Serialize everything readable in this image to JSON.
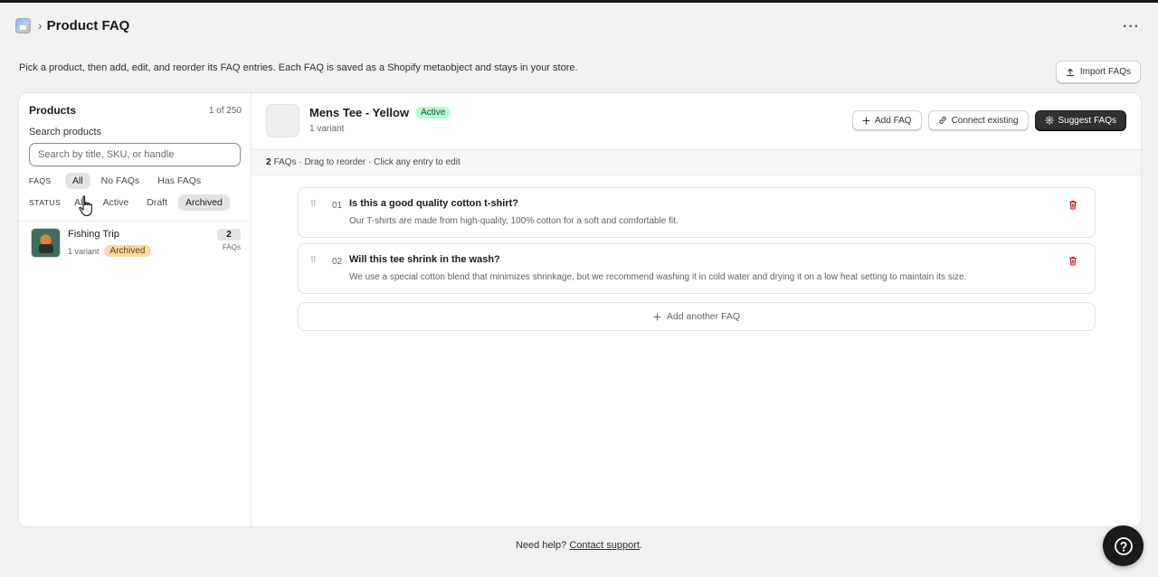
{
  "header": {
    "title": "Product FAQ",
    "breadcrumb_sep": "›",
    "more_label": "···"
  },
  "intro": "Pick a product, then add, edit, and reorder its FAQ entries. Each FAQ is saved as a Shopify metaobject and stays in your store.",
  "import_button": "Import FAQs",
  "sidebar": {
    "title": "Products",
    "count": "1 of 250",
    "search_label": "Search products",
    "search_placeholder": "Search by title, SKU, or handle",
    "search_value": "",
    "faq_filter": {
      "label": "FAQS",
      "options": [
        "All",
        "No FAQs",
        "Has FAQs"
      ],
      "selected": "All"
    },
    "status_filter": {
      "label": "STATUS",
      "options": [
        "All",
        "Active",
        "Draft",
        "Archived"
      ],
      "selected": "Archived"
    },
    "products": [
      {
        "name": "Fishing Trip",
        "variants": "1 variant",
        "status": "Archived",
        "faq_count": "2",
        "faq_count_label": "FAQs"
      }
    ]
  },
  "main": {
    "product_title": "Mens Tee - Yellow",
    "status": "Active",
    "variants": "1 variant",
    "actions": {
      "add_faq": "Add FAQ",
      "connect_existing": "Connect existing",
      "suggest_faqs": "Suggest FAQs"
    },
    "meta": {
      "count": "2",
      "text": "FAQs · Drag to reorder · Click any entry to edit"
    },
    "faqs": [
      {
        "number": "01",
        "question": "Is this a good quality cotton t-shirt?",
        "answer": "Our T-shirts are made from high-quality, 100% cotton for a soft and comfortable fit."
      },
      {
        "number": "02",
        "question": "Will this tee shrink in the wash?",
        "answer": "We use a special cotton blend that minimizes shrinkage, but we recommend washing it in cold water and drying it on a low heat setting to maintain its size."
      }
    ],
    "add_another": "Add another FAQ"
  },
  "footer": {
    "text": "Need help?",
    "link": "Contact support",
    "suffix": "."
  },
  "colors": {
    "accent_dark": "#303030",
    "badge_active_bg": "#b4fed2",
    "badge_archived_bg": "#ffd6a4",
    "trash_red": "#c70a24"
  }
}
